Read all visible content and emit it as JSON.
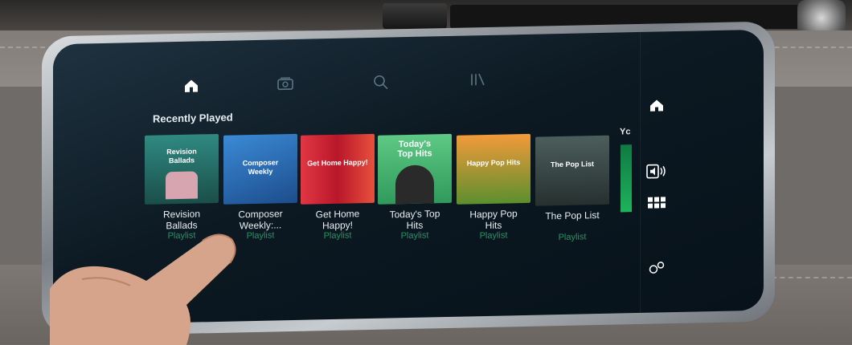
{
  "nav": {
    "icons": [
      "home-icon",
      "browse-icon",
      "search-icon",
      "library-icon"
    ],
    "active": "home-icon"
  },
  "section": {
    "title": "Recently Played"
  },
  "playlists": [
    {
      "title": "Revision\nBallads",
      "type": "Playlist",
      "art_text": "Revision\nBallads",
      "color": "#2f8a82"
    },
    {
      "title": "Composer\nWeekly:...",
      "type": "Playlist",
      "art_text": "Composer\nWeekly",
      "color": "#2b6cb0"
    },
    {
      "title": "Get Home\nHappy!",
      "type": "Playlist",
      "art_text": "Get Home Happy!",
      "color": "#d62f3c"
    },
    {
      "title": "Today's Top\nHits",
      "type": "Playlist",
      "art_text": "Today's\nTop Hits",
      "color": "#3fb56a"
    },
    {
      "title": "Happy Pop\nHits",
      "type": "Playlist",
      "art_text": "Happy Pop Hits",
      "color": "#e0702a"
    },
    {
      "title": "The Pop List",
      "type": "Playlist",
      "art_text": "The Pop List",
      "color": "#3c4d4c"
    }
  ],
  "partial_label": "Yc",
  "side": {
    "icons": [
      "home-icon",
      "audio-source-icon",
      "apps-grid-icon",
      "settings-icon"
    ]
  },
  "colors": {
    "accent": "#1db954",
    "screen": "#0c1922",
    "text": "#e9eff2"
  }
}
